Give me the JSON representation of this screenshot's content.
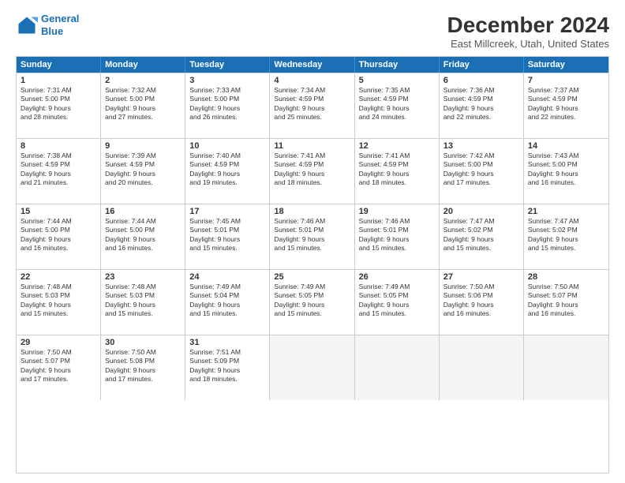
{
  "logo": {
    "line1": "General",
    "line2": "Blue"
  },
  "title": "December 2024",
  "subtitle": "East Millcreek, Utah, United States",
  "days": [
    "Sunday",
    "Monday",
    "Tuesday",
    "Wednesday",
    "Thursday",
    "Friday",
    "Saturday"
  ],
  "weeks": [
    [
      {
        "day": "1",
        "rise": "Sunrise: 7:31 AM",
        "set": "Sunset: 5:00 PM",
        "light": "Daylight: 9 hours",
        "light2": "and 28 minutes."
      },
      {
        "day": "2",
        "rise": "Sunrise: 7:32 AM",
        "set": "Sunset: 5:00 PM",
        "light": "Daylight: 9 hours",
        "light2": "and 27 minutes."
      },
      {
        "day": "3",
        "rise": "Sunrise: 7:33 AM",
        "set": "Sunset: 5:00 PM",
        "light": "Daylight: 9 hours",
        "light2": "and 26 minutes."
      },
      {
        "day": "4",
        "rise": "Sunrise: 7:34 AM",
        "set": "Sunset: 4:59 PM",
        "light": "Daylight: 9 hours",
        "light2": "and 25 minutes."
      },
      {
        "day": "5",
        "rise": "Sunrise: 7:35 AM",
        "set": "Sunset: 4:59 PM",
        "light": "Daylight: 9 hours",
        "light2": "and 24 minutes."
      },
      {
        "day": "6",
        "rise": "Sunrise: 7:36 AM",
        "set": "Sunset: 4:59 PM",
        "light": "Daylight: 9 hours",
        "light2": "and 22 minutes."
      },
      {
        "day": "7",
        "rise": "Sunrise: 7:37 AM",
        "set": "Sunset: 4:59 PM",
        "light": "Daylight: 9 hours",
        "light2": "and 22 minutes."
      }
    ],
    [
      {
        "day": "8",
        "rise": "Sunrise: 7:38 AM",
        "set": "Sunset: 4:59 PM",
        "light": "Daylight: 9 hours",
        "light2": "and 21 minutes."
      },
      {
        "day": "9",
        "rise": "Sunrise: 7:39 AM",
        "set": "Sunset: 4:59 PM",
        "light": "Daylight: 9 hours",
        "light2": "and 20 minutes."
      },
      {
        "day": "10",
        "rise": "Sunrise: 7:40 AM",
        "set": "Sunset: 4:59 PM",
        "light": "Daylight: 9 hours",
        "light2": "and 19 minutes."
      },
      {
        "day": "11",
        "rise": "Sunrise: 7:41 AM",
        "set": "Sunset: 4:59 PM",
        "light": "Daylight: 9 hours",
        "light2": "and 18 minutes."
      },
      {
        "day": "12",
        "rise": "Sunrise: 7:41 AM",
        "set": "Sunset: 4:59 PM",
        "light": "Daylight: 9 hours",
        "light2": "and 18 minutes."
      },
      {
        "day": "13",
        "rise": "Sunrise: 7:42 AM",
        "set": "Sunset: 5:00 PM",
        "light": "Daylight: 9 hours",
        "light2": "and 17 minutes."
      },
      {
        "day": "14",
        "rise": "Sunrise: 7:43 AM",
        "set": "Sunset: 5:00 PM",
        "light": "Daylight: 9 hours",
        "light2": "and 16 minutes."
      }
    ],
    [
      {
        "day": "15",
        "rise": "Sunrise: 7:44 AM",
        "set": "Sunset: 5:00 PM",
        "light": "Daylight: 9 hours",
        "light2": "and 16 minutes."
      },
      {
        "day": "16",
        "rise": "Sunrise: 7:44 AM",
        "set": "Sunset: 5:00 PM",
        "light": "Daylight: 9 hours",
        "light2": "and 16 minutes."
      },
      {
        "day": "17",
        "rise": "Sunrise: 7:45 AM",
        "set": "Sunset: 5:01 PM",
        "light": "Daylight: 9 hours",
        "light2": "and 15 minutes."
      },
      {
        "day": "18",
        "rise": "Sunrise: 7:46 AM",
        "set": "Sunset: 5:01 PM",
        "light": "Daylight: 9 hours",
        "light2": "and 15 minutes."
      },
      {
        "day": "19",
        "rise": "Sunrise: 7:46 AM",
        "set": "Sunset: 5:01 PM",
        "light": "Daylight: 9 hours",
        "light2": "and 15 minutes."
      },
      {
        "day": "20",
        "rise": "Sunrise: 7:47 AM",
        "set": "Sunset: 5:02 PM",
        "light": "Daylight: 9 hours",
        "light2": "and 15 minutes."
      },
      {
        "day": "21",
        "rise": "Sunrise: 7:47 AM",
        "set": "Sunset: 5:02 PM",
        "light": "Daylight: 9 hours",
        "light2": "and 15 minutes."
      }
    ],
    [
      {
        "day": "22",
        "rise": "Sunrise: 7:48 AM",
        "set": "Sunset: 5:03 PM",
        "light": "Daylight: 9 hours",
        "light2": "and 15 minutes."
      },
      {
        "day": "23",
        "rise": "Sunrise: 7:48 AM",
        "set": "Sunset: 5:03 PM",
        "light": "Daylight: 9 hours",
        "light2": "and 15 minutes."
      },
      {
        "day": "24",
        "rise": "Sunrise: 7:49 AM",
        "set": "Sunset: 5:04 PM",
        "light": "Daylight: 9 hours",
        "light2": "and 15 minutes."
      },
      {
        "day": "25",
        "rise": "Sunrise: 7:49 AM",
        "set": "Sunset: 5:05 PM",
        "light": "Daylight: 9 hours",
        "light2": "and 15 minutes."
      },
      {
        "day": "26",
        "rise": "Sunrise: 7:49 AM",
        "set": "Sunset: 5:05 PM",
        "light": "Daylight: 9 hours",
        "light2": "and 15 minutes."
      },
      {
        "day": "27",
        "rise": "Sunrise: 7:50 AM",
        "set": "Sunset: 5:06 PM",
        "light": "Daylight: 9 hours",
        "light2": "and 16 minutes."
      },
      {
        "day": "28",
        "rise": "Sunrise: 7:50 AM",
        "set": "Sunset: 5:07 PM",
        "light": "Daylight: 9 hours",
        "light2": "and 16 minutes."
      }
    ],
    [
      {
        "day": "29",
        "rise": "Sunrise: 7:50 AM",
        "set": "Sunset: 5:07 PM",
        "light": "Daylight: 9 hours",
        "light2": "and 17 minutes."
      },
      {
        "day": "30",
        "rise": "Sunrise: 7:50 AM",
        "set": "Sunset: 5:08 PM",
        "light": "Daylight: 9 hours",
        "light2": "and 17 minutes."
      },
      {
        "day": "31",
        "rise": "Sunrise: 7:51 AM",
        "set": "Sunset: 5:09 PM",
        "light": "Daylight: 9 hours",
        "light2": "and 18 minutes."
      },
      null,
      null,
      null,
      null
    ]
  ]
}
